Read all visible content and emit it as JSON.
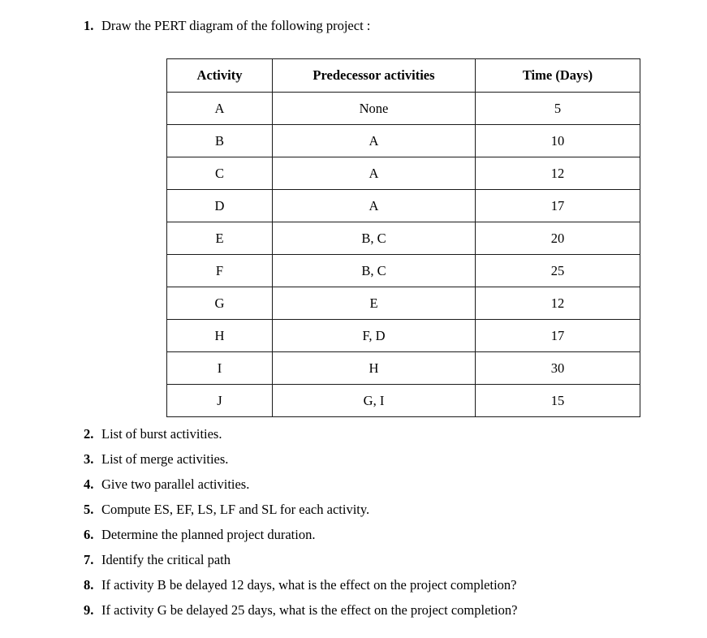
{
  "question_1": {
    "number": "1.",
    "text": "Draw the PERT diagram of the following project :"
  },
  "table": {
    "headers": {
      "activity": "Activity",
      "predecessor": "Predecessor activities",
      "time": "Time (Days)"
    },
    "rows": [
      {
        "activity": "A",
        "predecessor": "None",
        "time": "5"
      },
      {
        "activity": "B",
        "predecessor": "A",
        "time": "10"
      },
      {
        "activity": "C",
        "predecessor": "A",
        "time": "12"
      },
      {
        "activity": "D",
        "predecessor": "A",
        "time": "17"
      },
      {
        "activity": "E",
        "predecessor": "B, C",
        "time": "20"
      },
      {
        "activity": "F",
        "predecessor": "B, C",
        "time": "25"
      },
      {
        "activity": "G",
        "predecessor": "E",
        "time": "12"
      },
      {
        "activity": "H",
        "predecessor": "F, D",
        "time": "17"
      },
      {
        "activity": "I",
        "predecessor": "H",
        "time": "30"
      },
      {
        "activity": "J",
        "predecessor": "G, I",
        "time": "15"
      }
    ]
  },
  "questions": [
    {
      "number": "2.",
      "text": "List of burst activities."
    },
    {
      "number": "3.",
      "text": "List of merge activities."
    },
    {
      "number": "4.",
      "text": "Give two parallel activities."
    },
    {
      "number": "5.",
      "text": "Compute ES, EF, LS, LF and SL for each activity."
    },
    {
      "number": "6.",
      "text": "Determine the planned project duration."
    },
    {
      "number": "7.",
      "text": "Identify the critical path"
    },
    {
      "number": "8.",
      "text": "If activity B be delayed 12 days, what is the effect on the project completion?"
    },
    {
      "number": "9.",
      "text": "If activity G be delayed 25 days, what is the effect on the project completion?"
    }
  ]
}
